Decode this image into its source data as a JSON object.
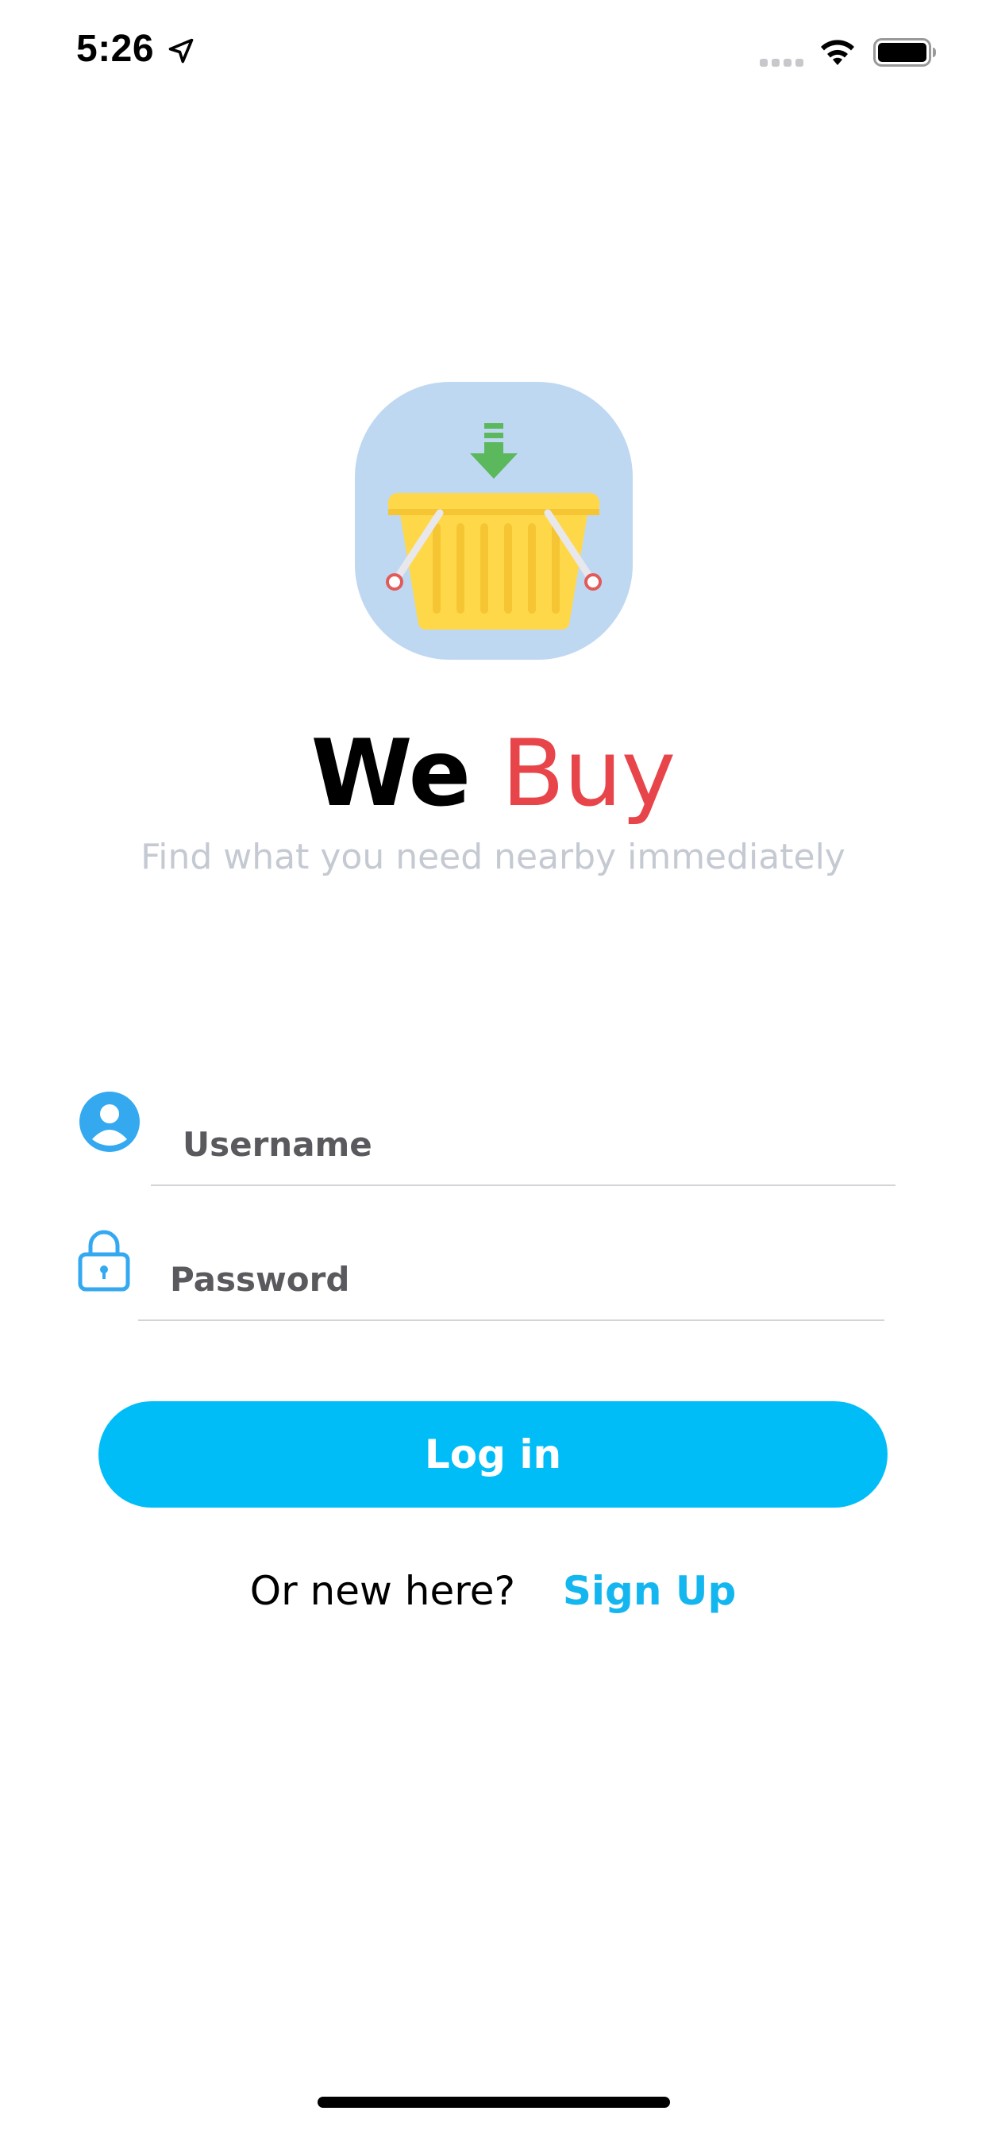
{
  "status_bar": {
    "time": "5:26",
    "icons": [
      "location-arrow-icon",
      "cellular-signal-icon",
      "wifi-icon",
      "battery-icon"
    ]
  },
  "brand": {
    "logo_icon": "shopping-basket-download-icon",
    "title_part1": "We",
    "title_part2": "Buy",
    "tagline": "Find what you need nearby immediately"
  },
  "form": {
    "username_placeholder": "Username",
    "username_value": "",
    "password_placeholder": "Password",
    "password_value": "",
    "login_label": "Log in"
  },
  "signup": {
    "prompt": "Or new here?",
    "link_label": "Sign Up"
  },
  "colors": {
    "accent": "#00bdf7",
    "brand_red": "#e8454a",
    "icon_blue": "#35a9f0",
    "logo_bg": "#bfd8f2",
    "basket_yellow": "#ffd84a",
    "arrow_green": "#5cb85c"
  }
}
